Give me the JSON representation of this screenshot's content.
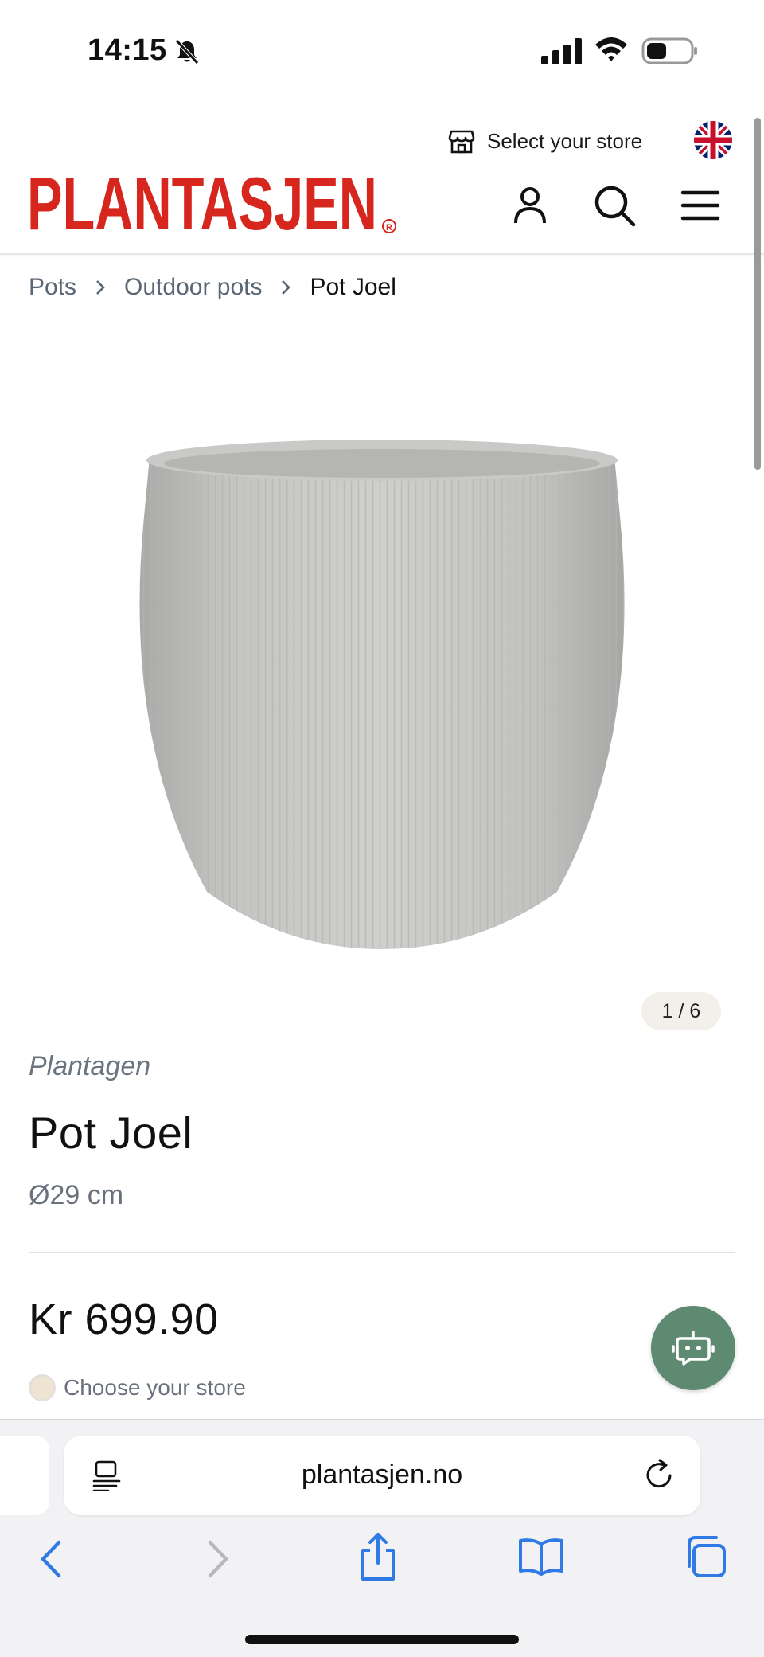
{
  "status_bar": {
    "time": "14:15"
  },
  "header": {
    "store_label": "Select your store",
    "logo_text": "PLANTASJEN",
    "logo_color": "#d7261e",
    "icons": [
      "account-icon",
      "search-icon",
      "menu-icon",
      "store-icon",
      "uk-flag-icon"
    ]
  },
  "breadcrumb": {
    "items": [
      "Pots",
      "Outdoor pots"
    ],
    "current": "Pot Joel"
  },
  "gallery": {
    "counter": "1 / 6"
  },
  "product": {
    "brand": "Plantagen",
    "title": "Pot Joel",
    "size": "Ø29 cm",
    "price": "Kr 699.90",
    "choose_store": "Choose your store"
  },
  "chat": {
    "icon": "chatbot-icon",
    "color": "#5d8a70"
  },
  "browser": {
    "url": "plantasjen.no",
    "toolbar_icons": [
      "back-icon",
      "forward-icon",
      "share-icon",
      "bookmarks-icon",
      "tabs-icon"
    ]
  }
}
